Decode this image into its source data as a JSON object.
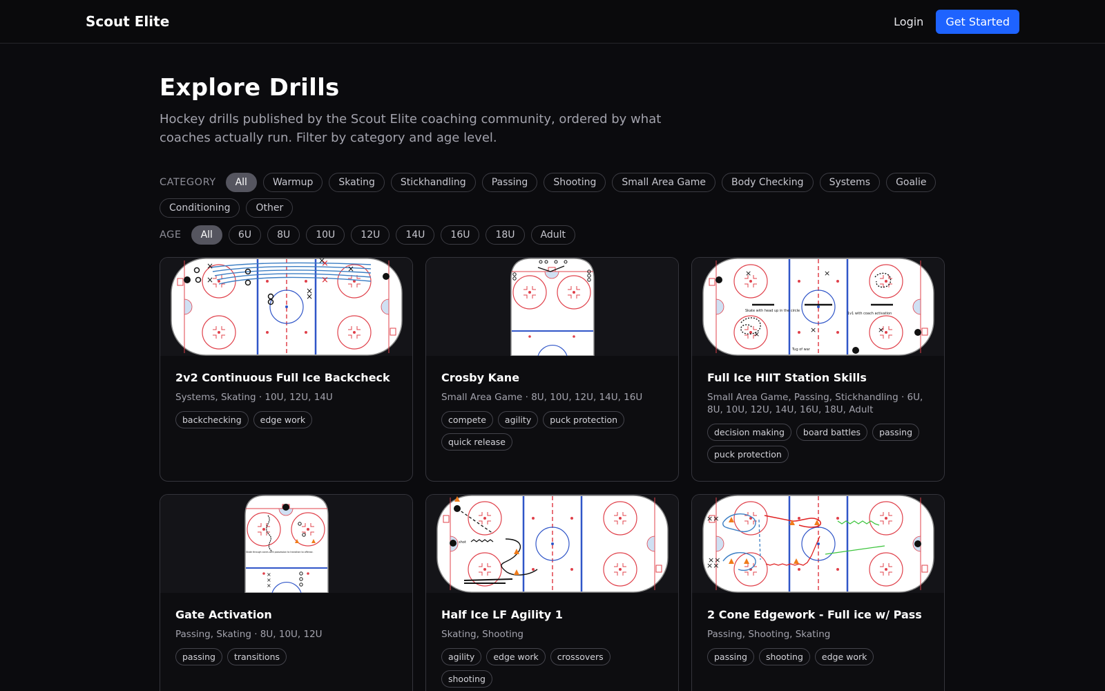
{
  "brand": "Scout Elite",
  "nav": {
    "login": "Login",
    "cta": "Get Started"
  },
  "page": {
    "title": "Explore Drills",
    "subtitle": "Hockey drills published by the Scout Elite coaching community, ordered by what coaches actually run. Filter by category and age level."
  },
  "filters": {
    "category_label": "CATEGORY",
    "categories": [
      "All",
      "Warmup",
      "Skating",
      "Stickhandling",
      "Passing",
      "Shooting",
      "Small Area Game",
      "Body Checking",
      "Systems",
      "Goalie",
      "Conditioning",
      "Other"
    ],
    "category_selected": "All",
    "age_label": "AGE",
    "ages": [
      "All",
      "6U",
      "8U",
      "10U",
      "12U",
      "14U",
      "16U",
      "18U",
      "Adult"
    ],
    "age_selected": "All"
  },
  "drills": [
    {
      "title": "2v2 Continuous Full Ice Backcheck",
      "meta": "Systems, Skating · 10U, 12U, 14U",
      "tags": [
        "backchecking",
        "edge work"
      ],
      "rink": "full"
    },
    {
      "title": "Crosby Kane",
      "meta": "Small Area Game · 8U, 10U, 12U, 14U, 16U",
      "tags": [
        "compete",
        "agility",
        "puck protection",
        "quick release"
      ],
      "rink": "half"
    },
    {
      "title": "Full Ice HIIT Station Skills",
      "meta": "Small Area Game, Passing, Stickhandling · 6U, 8U, 10U, 12U, 14U, 16U, 18U, Adult",
      "tags": [
        "decision making",
        "board battles",
        "passing",
        "puck protection"
      ],
      "rink": "full",
      "labels": [
        "Skate with head up in the circle",
        "1v1 with coach activation",
        "Tug of war"
      ]
    },
    {
      "title": "Gate Activation",
      "meta": "Passing, Skating · 8U, 10U, 12U",
      "tags": [
        "passing",
        "transitions"
      ],
      "rink": "half",
      "labels": [
        "Skate through cones with possession to transition to offense."
      ]
    },
    {
      "title": "Half Ice LF Agility 1",
      "meta": "Skating, Shooting",
      "tags": [
        "agility",
        "edge work",
        "crossovers",
        "shooting"
      ],
      "rink": "full",
      "labels": [
        "shot"
      ]
    },
    {
      "title": "2 Cone Edgework - Full ice w/ Pass",
      "meta": "Passing, Shooting, Skating",
      "tags": [
        "passing",
        "shooting",
        "edge work"
      ],
      "rink": "full"
    }
  ],
  "colors": {
    "accent": "#1e63ff",
    "rink_red": "#e0404a",
    "rink_blue": "#2f55c8",
    "background": "#0b0b0e"
  }
}
